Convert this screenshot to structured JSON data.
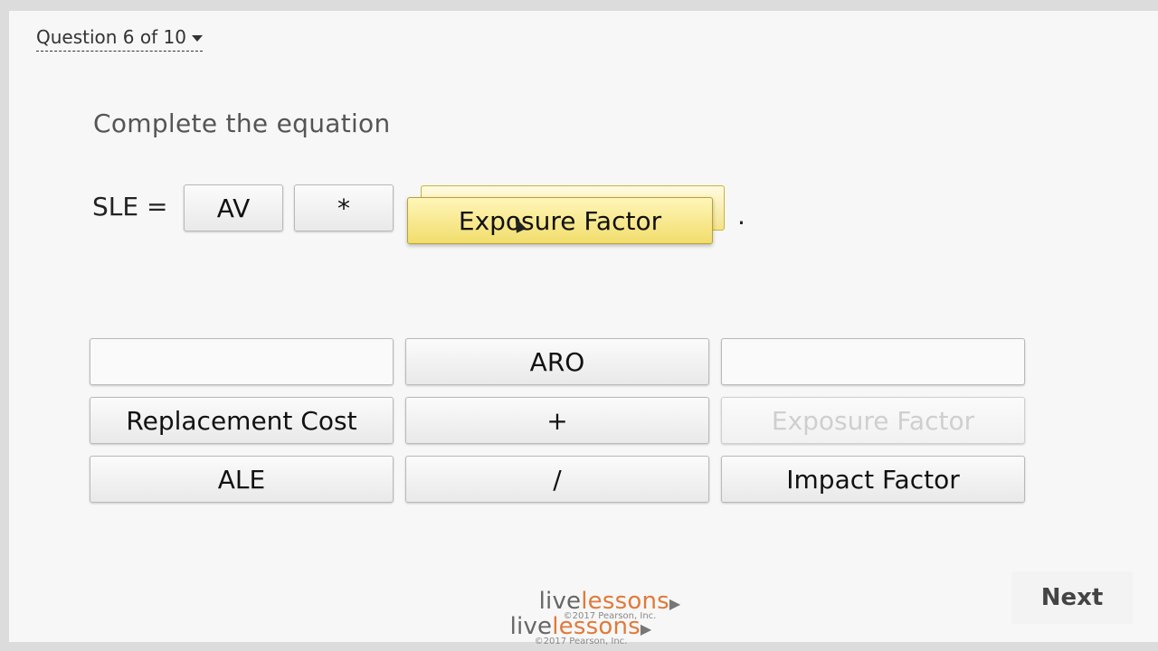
{
  "nav": {
    "question_label": "Question 6 of 10"
  },
  "prompt": "Complete the equation",
  "equation": {
    "lhs": "SLE =",
    "slot1": "AV",
    "slot2": "*",
    "dragging": "Exposure Factor",
    "period": "."
  },
  "answer_bank": [
    {
      "label": ""
    },
    {
      "label": "ARO"
    },
    {
      "label": ""
    },
    {
      "label": "Replacement Cost"
    },
    {
      "label": "+"
    },
    {
      "label": "Exposure Factor"
    },
    {
      "label": "ALE"
    },
    {
      "label": "/"
    },
    {
      "label": "Impact Factor"
    }
  ],
  "footer": {
    "brand_live": "live",
    "brand_lessons": "lessons",
    "play_glyph": "▶",
    "copyright": "©2017 Pearson, Inc.",
    "next_label": "Next"
  },
  "colors": {
    "drag_tile": "#f1dd6c",
    "brand_orange": "#e07a3a"
  }
}
